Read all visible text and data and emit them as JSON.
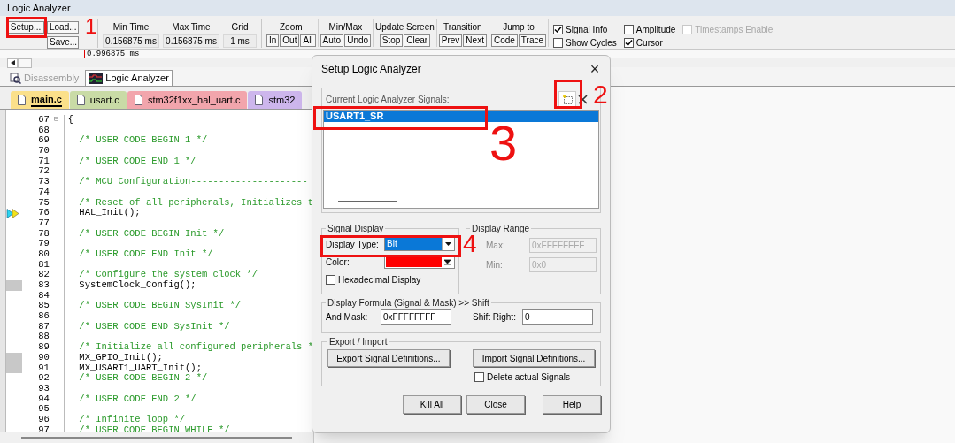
{
  "window": {
    "title": "Logic Analyzer"
  },
  "toolbar": {
    "setup": "Setup...",
    "load": "Load...",
    "save": "Save...",
    "fields": [
      {
        "label": "Min Time",
        "value": "0.156875 ms"
      },
      {
        "label": "Max Time",
        "value": "0.156875 ms"
      },
      {
        "label": "Grid",
        "value": "1 ms"
      }
    ],
    "groups": [
      {
        "label": "Zoom",
        "buttons": [
          "In",
          "Out",
          "All"
        ]
      },
      {
        "label": "Min/Max",
        "buttons": [
          "Auto",
          "Undo"
        ]
      },
      {
        "label": "Update Screen",
        "buttons": [
          "Stop",
          "Clear"
        ]
      },
      {
        "label": "Transition",
        "buttons": [
          "Prev",
          "Next"
        ]
      },
      {
        "label": "Jump to",
        "buttons": [
          "Code",
          "Trace"
        ]
      }
    ],
    "checks": [
      {
        "label": "Signal Info",
        "checked": true,
        "disabled": false
      },
      {
        "label": "Show Cycles",
        "checked": false,
        "disabled": false
      },
      {
        "label": "Amplitude",
        "checked": false,
        "disabled": false
      },
      {
        "label": "Cursor",
        "checked": true,
        "disabled": false
      },
      {
        "label": "Timestamps Enable",
        "checked": false,
        "disabled": true
      }
    ]
  },
  "waveform": {
    "cursor_time": "0.996875 ms"
  },
  "view_tabs": [
    {
      "label": "Disassembly",
      "selected": false
    },
    {
      "label": "Logic Analyzer",
      "selected": true
    }
  ],
  "file_tabs": [
    {
      "label": "main.c",
      "selected": true,
      "color": "#fbe08a"
    },
    {
      "label": "usart.c",
      "selected": false,
      "color": "#c9dba6"
    },
    {
      "label": "stm32f1xx_hal_uart.c",
      "selected": false,
      "color": "#f2a5ac"
    },
    {
      "label": "stm32",
      "selected": false,
      "color": "#cdb6ec"
    }
  ],
  "code_lines": [
    {
      "num": "67",
      "text": "{",
      "kind": "code",
      "fold": "⊟"
    },
    {
      "num": "68",
      "kind": "blank"
    },
    {
      "num": "69",
      "text": "  /* USER CODE BEGIN 1 */",
      "kind": "comment"
    },
    {
      "num": "70",
      "kind": "blank"
    },
    {
      "num": "71",
      "text": "  /* USER CODE END 1 */",
      "kind": "comment"
    },
    {
      "num": "72",
      "kind": "blank"
    },
    {
      "num": "73",
      "text": "  /* MCU Configuration---------------------",
      "kind": "comment"
    },
    {
      "num": "74",
      "kind": "blank"
    },
    {
      "num": "75",
      "text": "  /* Reset of all peripherals, Initializes t",
      "kind": "comment"
    },
    {
      "num": "76",
      "text": "  HAL_Init();",
      "kind": "current"
    },
    {
      "num": "77",
      "kind": "blank"
    },
    {
      "num": "78",
      "text": "  /* USER CODE BEGIN Init */",
      "kind": "comment"
    },
    {
      "num": "79",
      "kind": "blank"
    },
    {
      "num": "80",
      "text": "  /* USER CODE END Init */",
      "kind": "comment"
    },
    {
      "num": "81",
      "kind": "blank"
    },
    {
      "num": "82",
      "text": "  /* Configure the system clock */",
      "kind": "comment"
    },
    {
      "num": "83",
      "text": "  SystemClock_Config();",
      "kind": "executable"
    },
    {
      "num": "84",
      "kind": "blank"
    },
    {
      "num": "85",
      "text": "  /* USER CODE BEGIN SysInit */",
      "kind": "comment"
    },
    {
      "num": "86",
      "kind": "blank"
    },
    {
      "num": "87",
      "text": "  /* USER CODE END SysInit */",
      "kind": "comment"
    },
    {
      "num": "88",
      "kind": "blank"
    },
    {
      "num": "89",
      "text": "  /* Initialize all configured peripherals *",
      "kind": "comment"
    },
    {
      "num": "90",
      "text": "  MX_GPIO_Init();",
      "kind": "executable"
    },
    {
      "num": "91",
      "text": "  MX_USART1_UART_Init();",
      "kind": "executable"
    },
    {
      "num": "92",
      "text": "  /* USER CODE BEGIN 2 */",
      "kind": "comment"
    },
    {
      "num": "93",
      "kind": "blank"
    },
    {
      "num": "94",
      "text": "  /* USER CODE END 2 */",
      "kind": "comment"
    },
    {
      "num": "95",
      "kind": "blank"
    },
    {
      "num": "96",
      "text": "  /* Infinite loop */",
      "kind": "comment"
    },
    {
      "num": "97",
      "text": "  /* USER CODE BEGIN WHILE */",
      "kind": "comment"
    }
  ],
  "dialog": {
    "title": "Setup Logic Analyzer",
    "close": "×",
    "signals_label": "Current Logic Analyzer Signals:",
    "signals": [
      {
        "name": "USART1_SR",
        "selected": true
      }
    ],
    "signal_display": {
      "title": "Signal Display",
      "type_label": "Display Type:",
      "type_value": "Bit",
      "color_label": "Color:",
      "color": "#ff0000",
      "hex_label": "Hexadecimal Display",
      "hex_checked": false
    },
    "display_range": {
      "title": "Display Range",
      "max_label": "Max:",
      "max_value": "0xFFFFFFFF",
      "min_label": "Min:",
      "min_value": "0x0",
      "disabled": true
    },
    "formula": {
      "title": "Display Formula (Signal & Mask) >> Shift",
      "mask_label": "And Mask:",
      "mask_value": "0xFFFFFFFF",
      "shift_label": "Shift Right:",
      "shift_value": "0"
    },
    "export_import": {
      "title": "Export / Import",
      "export": "Export Signal Definitions...",
      "import": "Import Signal Definitions...",
      "delete_label": "Delete actual Signals",
      "delete_checked": false
    },
    "buttons": [
      "Kill All",
      "Close",
      "Help"
    ]
  },
  "annotations": [
    {
      "text": "1"
    },
    {
      "text": "2"
    },
    {
      "text": "3"
    },
    {
      "text": "4"
    }
  ]
}
